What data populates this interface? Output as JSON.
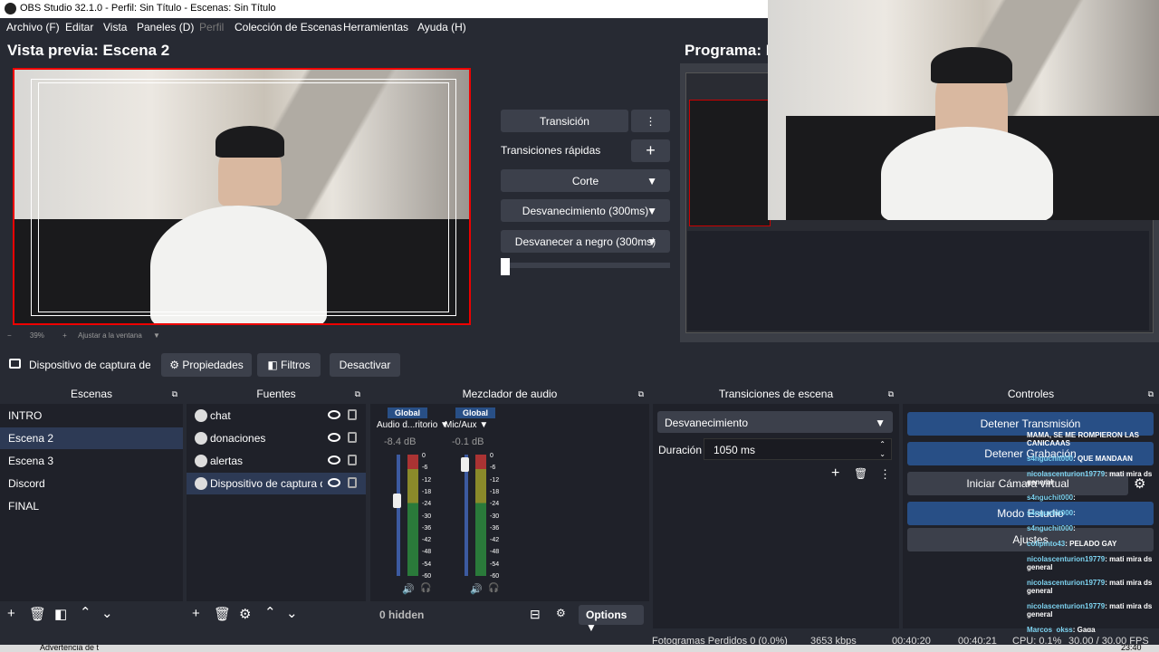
{
  "window": {
    "title": "OBS Studio 32.1.0 - Perfil: Sin Título - Escenas: Sin Título"
  },
  "menu": [
    "Archivo (F)",
    "Editar",
    "Vista",
    "Paneles (D)",
    "Perfil",
    "Colección de Escenas",
    "Herramientas",
    "Ayuda (H)"
  ],
  "preview": {
    "title": "Vista previa: Escena 2",
    "zoom": "39%",
    "fit_label": "Ajustar a la ventana"
  },
  "program": {
    "title": "Programa: E"
  },
  "transitions_center": {
    "transition_button": "Transición",
    "quick_transitions": "Transiciones rápidas",
    "items": [
      "Corte",
      "Desvanecimiento (300ms)",
      "Desvanecer a negro (300ms)"
    ]
  },
  "source_toolbar": {
    "source_name": "Dispositivo de captura de v",
    "properties": "Propiedades",
    "filters": "Filtros",
    "deactivate": "Desactivar"
  },
  "scenes": {
    "title": "Escenas",
    "items": [
      "INTRO",
      "Escena 2",
      "Escena 3",
      "Discord",
      "FINAL"
    ],
    "selected": 1
  },
  "sources": {
    "title": "Fuentes",
    "items": [
      "chat",
      "donaciones",
      "alertas",
      "Dispositivo de captura de"
    ],
    "selected": 3
  },
  "mixer": {
    "title": "Mezclador de audio",
    "channels": [
      {
        "badge": "Global",
        "name": "Audio d...ritorio",
        "db": "-8.4 dB",
        "level": 0.62
      },
      {
        "badge": "Global",
        "name": "Mic/Aux",
        "db": "-0.1 dB",
        "level": 0.92
      }
    ],
    "scale": [
      "0",
      "-6",
      "-12",
      "-18",
      "-24",
      "-30",
      "-36",
      "-42",
      "-48",
      "-54",
      "-60"
    ],
    "hidden": "0 hidden",
    "options": "Options"
  },
  "scene_transitions": {
    "title": "Transiciones de escena",
    "selected": "Desvanecimiento",
    "duration_label": "Duración",
    "duration_value": "1050 ms"
  },
  "controls": {
    "title": "Controles",
    "buttons": [
      "Detener Transmisión",
      "Detener Grabación",
      "Iniciar Cámara virtual",
      "Modo Estudio",
      "Ajustes"
    ]
  },
  "chat_overlay": [
    {
      "name": "",
      "msg": "MAMA, SE ME ROMPIERON LAS CANICAAAS"
    },
    {
      "name": "s4nguchit000",
      "msg": ": QUE MANDAAN"
    },
    {
      "name": "nicolascenturion19779",
      "msg": ": mati mira ds general"
    },
    {
      "name": "s4nguchit000",
      "msg": ":"
    },
    {
      "name": "s4nguchit000",
      "msg": ":"
    },
    {
      "name": "s4nguchit000",
      "msg": ":"
    },
    {
      "name": "colipinto43",
      "msg": ": PELADO GAY"
    },
    {
      "name": "nicolascenturion19779",
      "msg": ": mati mira ds general"
    },
    {
      "name": "nicolascenturion19779",
      "msg": ": mati mira ds general"
    },
    {
      "name": "nicolascenturion19779",
      "msg": ": mati mira ds general"
    },
    {
      "name": "Marcos_okss",
      "msg": ": Gaga"
    }
  ],
  "statusbar": {
    "dropped": "Fotogramas Perdidos 0 (0.0%)",
    "bitrate": "3653 kbps",
    "t1": "00:40:20",
    "t2": "00:40:21",
    "cpu": "CPU: 0.1%",
    "fps": "30.00 / 30.00 FPS"
  },
  "taskbar": {
    "item": "Advertencia de t",
    "time": "23:40"
  }
}
